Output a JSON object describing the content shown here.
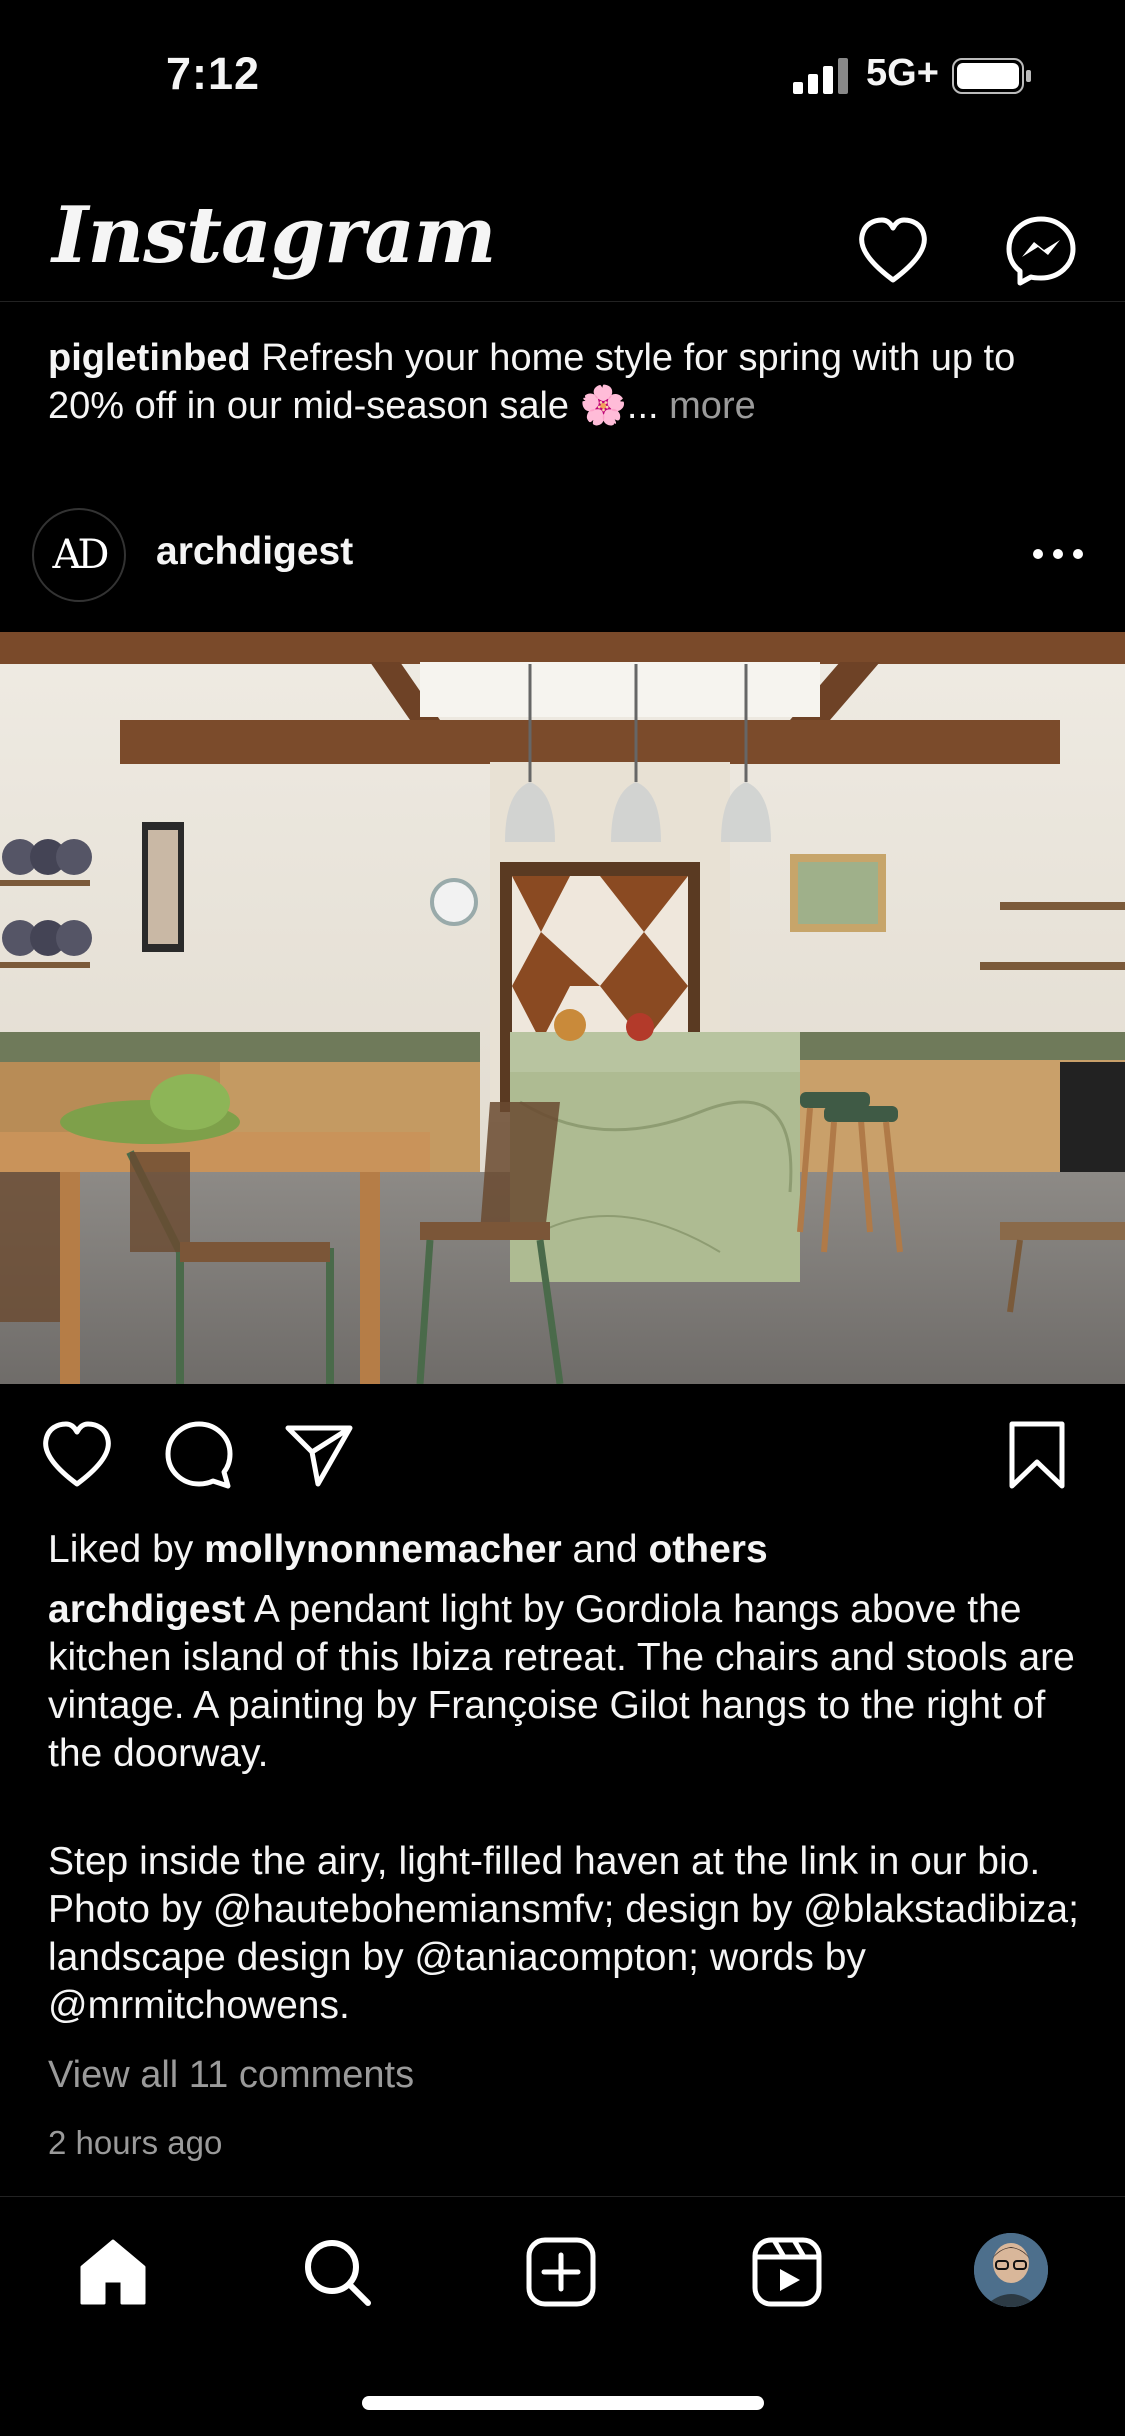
{
  "status_bar": {
    "time": "7:12",
    "network": "5G+"
  },
  "header": {
    "app_name": "Instagram"
  },
  "promo": {
    "username": "pigletinbed",
    "text": "Refresh your home style for spring with up to 20% off in our mid-season sale 🌸...",
    "more_label": "more"
  },
  "post": {
    "avatar_text": "AD",
    "username": "archdigest",
    "likes_prefix": "Liked by",
    "liked_by_user": "mollynonnemacher",
    "likes_and": "and",
    "likes_others": "others",
    "caption_user": "archdigest",
    "caption_text": "A pendant light by Gordiola hangs above the kitchen island of this Ibiza retreat. The chairs and stools are vintage. A painting by Françoise Gilot hangs to the right of the doorway.",
    "caption_text_2": "Step inside the airy, light-filled haven at the link in our bio. Photo by @hautebohemiansmfv; design by @blakstadibiza; landscape design by @taniacompton; words by @mrmitchowens.",
    "view_comments": "View all 11 comments",
    "time_ago": "2 hours ago"
  },
  "colors": {
    "background": "#000000",
    "text": "#f5f5f5",
    "muted": "#9a9a9a"
  }
}
